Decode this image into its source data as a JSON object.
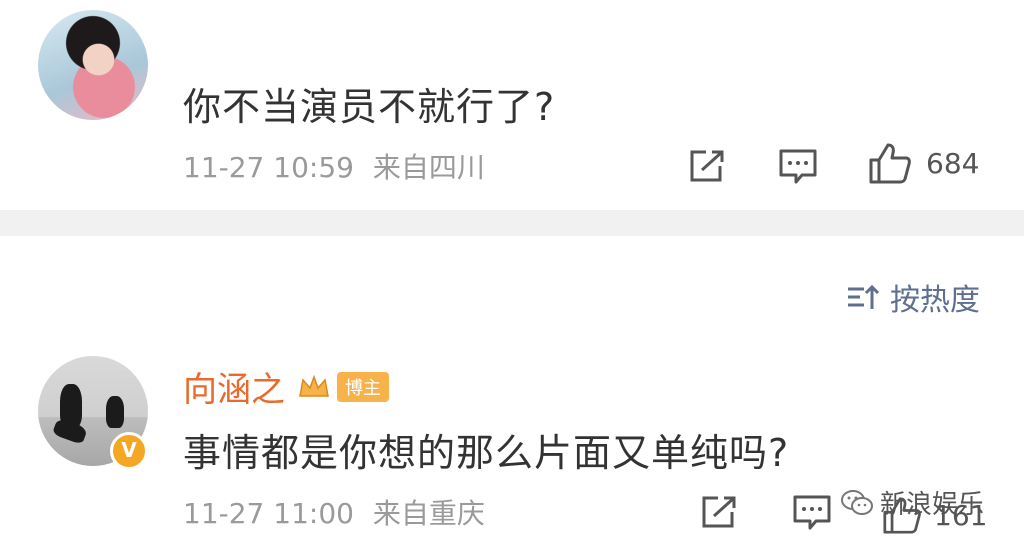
{
  "comment1": {
    "text": "你不当演员不就行了?",
    "time": "11-27 10:59",
    "location": "来自四川",
    "likes": "684"
  },
  "sort": {
    "label": "按热度"
  },
  "comment2": {
    "username": "向涵之",
    "badge": "博主",
    "text": "事情都是你想的那么片面又单纯吗?",
    "time": "11-27 11:00",
    "location": "来自重庆",
    "likes": "161"
  },
  "watermark": {
    "text": "新浪娱乐"
  },
  "colors": {
    "username": "#e86b2c",
    "badge": "#f7b24a",
    "sort": "#5e6f8f"
  },
  "icons": [
    "share-icon",
    "comment-icon",
    "like-icon",
    "sort-icon",
    "verified-icon",
    "crown-icon",
    "wechat-icon"
  ]
}
